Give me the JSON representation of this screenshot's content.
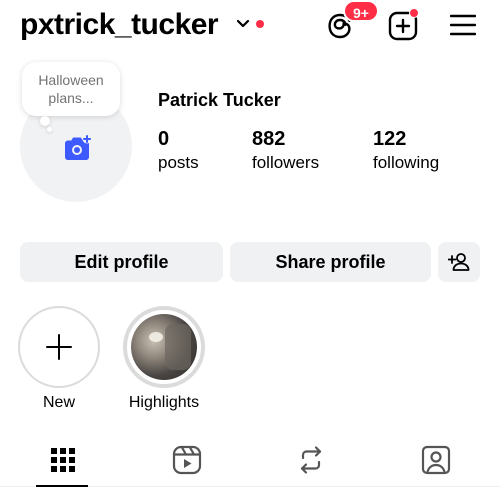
{
  "header": {
    "username": "pxtrick_tucker",
    "threads_badge": "9+",
    "icons": [
      "chevron-down-icon",
      "threads-icon",
      "add-post-icon",
      "menu-icon"
    ],
    "notification_color": "#ff2d46"
  },
  "profile": {
    "note": "Halloween plans...",
    "display_name": "Patrick Tucker",
    "stats": [
      {
        "value": "0",
        "label": "posts"
      },
      {
        "value": "882",
        "label": "followers"
      },
      {
        "value": "122",
        "label": "following"
      }
    ],
    "avatar_icon": "camera-add-icon",
    "accent_color": "#3d5afe"
  },
  "actions": {
    "edit_label": "Edit profile",
    "share_label": "Share profile",
    "add_user_icon": "add-user-icon"
  },
  "highlights": {
    "new_label": "New",
    "items": [
      {
        "label": "Highlights"
      }
    ]
  },
  "tabs": {
    "items": [
      "grid-icon",
      "reels-icon",
      "reposts-icon",
      "tagged-icon"
    ],
    "selected": "grid-icon"
  }
}
